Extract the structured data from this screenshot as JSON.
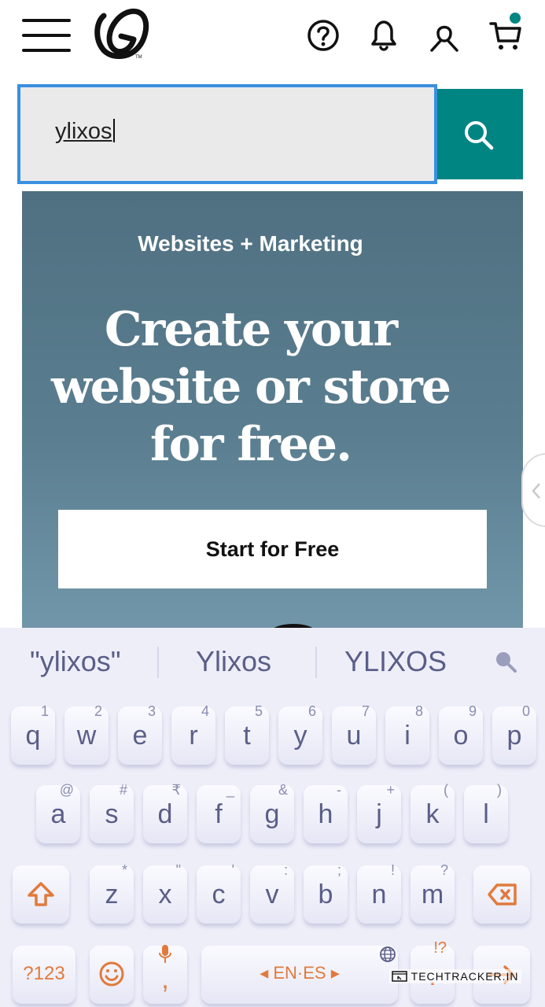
{
  "header": {
    "menu_icon": "hamburger-menu-icon",
    "logo": "godaddy-logo",
    "icons": [
      "help-icon",
      "bell-icon",
      "account-icon",
      "cart-icon"
    ],
    "cart_badge_color": "#008583"
  },
  "search": {
    "value": "ylixos",
    "button_icon": "search-icon",
    "accent": "#008583",
    "focus_border": "#3a8fe0"
  },
  "banner": {
    "eyebrow": "Websites + Marketing",
    "headline_line1": "Create your",
    "headline_line2": "website or store",
    "headline_line3": "for free.",
    "cta_label": "Start for Free"
  },
  "keyboard": {
    "suggestions": [
      "\"ylixos\"",
      "Ylixos",
      "YLIXOS"
    ],
    "row1": [
      {
        "k": "q",
        "alt": "1"
      },
      {
        "k": "w",
        "alt": "2"
      },
      {
        "k": "e",
        "alt": "3"
      },
      {
        "k": "r",
        "alt": "4"
      },
      {
        "k": "t",
        "alt": "5"
      },
      {
        "k": "y",
        "alt": "6"
      },
      {
        "k": "u",
        "alt": "7"
      },
      {
        "k": "i",
        "alt": "8"
      },
      {
        "k": "o",
        "alt": "9"
      },
      {
        "k": "p",
        "alt": "0"
      }
    ],
    "row2": [
      {
        "k": "a",
        "alt": "@"
      },
      {
        "k": "s",
        "alt": "#"
      },
      {
        "k": "d",
        "alt": "₹"
      },
      {
        "k": "f",
        "alt": "_"
      },
      {
        "k": "g",
        "alt": "&"
      },
      {
        "k": "h",
        "alt": "-"
      },
      {
        "k": "j",
        "alt": "+"
      },
      {
        "k": "k",
        "alt": "("
      },
      {
        "k": "l",
        "alt": ")"
      }
    ],
    "row3": [
      {
        "k": "z",
        "alt": "*"
      },
      {
        "k": "x",
        "alt": "\""
      },
      {
        "k": "c",
        "alt": "'"
      },
      {
        "k": "v",
        "alt": ":"
      },
      {
        "k": "b",
        "alt": ";"
      },
      {
        "k": "n",
        "alt": "!"
      },
      {
        "k": "m",
        "alt": "?"
      }
    ],
    "symbols_label": "?123",
    "comma_label": ",",
    "space_label": "EN·ES",
    "period_label": ".",
    "period_alt": "!?",
    "accent_color": "#e07a3c"
  },
  "watermark": "TECHTRACKER.IN"
}
